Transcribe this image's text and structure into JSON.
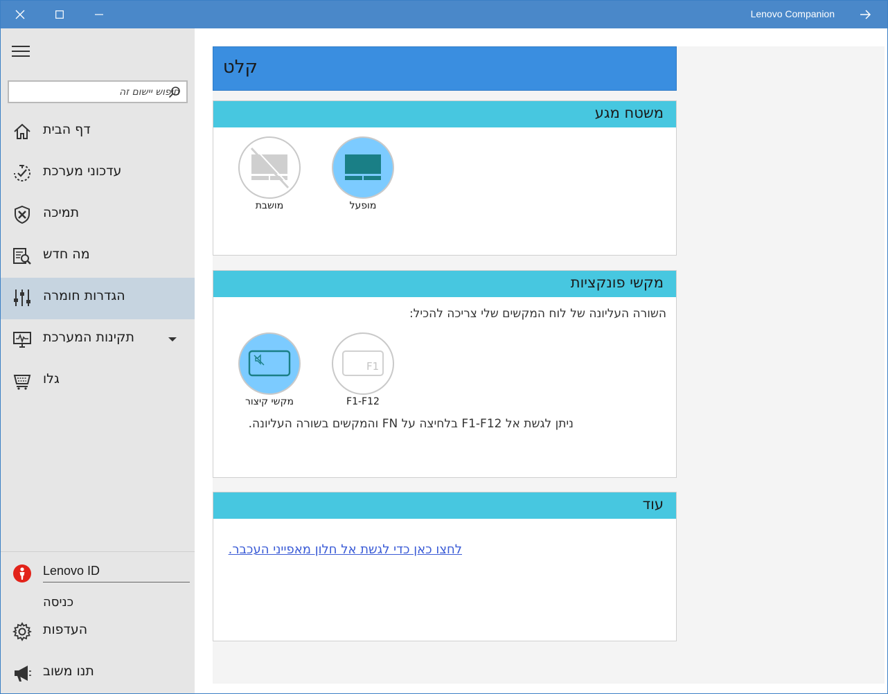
{
  "window": {
    "title": "Lenovo Companion",
    "accent_color": "#4a88c9"
  },
  "sidebar": {
    "search_placeholder": "חיפוש יישום זה",
    "items": [
      {
        "label": "דף הבית",
        "icon": "home-icon"
      },
      {
        "label": "עדכוני מערכת",
        "icon": "system-update-icon"
      },
      {
        "label": "תמיכה",
        "icon": "support-shield-icon"
      },
      {
        "label": "מה חדש",
        "icon": "whats-new-icon"
      },
      {
        "label": "הגדרות חומרה",
        "icon": "sliders-icon",
        "active": true
      },
      {
        "label": "תקינות המערכת",
        "icon": "system-health-icon",
        "expandable": true
      },
      {
        "label": "גלו",
        "icon": "discover-icon"
      }
    ],
    "lenovo_id": "Lenovo ID",
    "signin": "כניסה",
    "bottom_items": [
      {
        "label": "העדפות",
        "icon": "gear-icon"
      },
      {
        "label": "תנו משוב",
        "icon": "megaphone-icon"
      }
    ]
  },
  "page": {
    "title": "קלט",
    "header_color": "#3a8ee0",
    "section_color": "#47c7e0"
  },
  "touchpad": {
    "title": "משטח מגע",
    "options": [
      {
        "label": "מופעל",
        "icon": "touchpad-icon",
        "selected": true
      },
      {
        "label": "מושבת",
        "icon": "touchpad-disabled-icon",
        "selected": false
      }
    ]
  },
  "function_keys": {
    "title": "מקשי פונקציות",
    "description": "השורה העליונה של לוח המקשים שלי צריכה להכיל:",
    "options": [
      {
        "label": "F1-F12",
        "icon": "f1-key-icon",
        "selected": false
      },
      {
        "label": "מקשי קיצור",
        "icon": "hotkey-mute-icon",
        "selected": true
      }
    ],
    "f1_glyph": "F1",
    "note": "ניתן לגשת אל F1-F12 בלחיצה על FN והמקשים בשורה העליונה."
  },
  "more": {
    "title": "עוד",
    "link": "לחצו כאן כדי לגשת אל חלון מאפייני העכבר."
  }
}
